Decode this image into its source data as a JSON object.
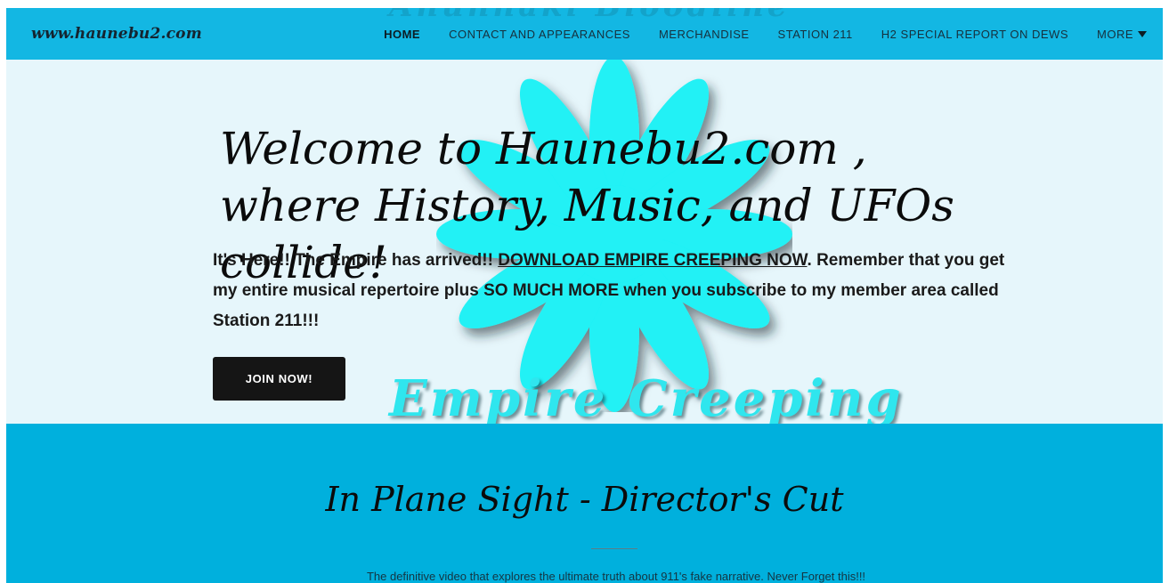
{
  "header": {
    "logo": "www.haunebu2.com",
    "ghost_text": "Anunnaki Bloodline",
    "nav": [
      {
        "label": "HOME",
        "active": true
      },
      {
        "label": "CONTACT AND APPEARANCES",
        "active": false
      },
      {
        "label": "MERCHANDISE",
        "active": false
      },
      {
        "label": "STATION 211",
        "active": false
      },
      {
        "label": "H2 SPECIAL REPORT ON DEWS",
        "active": false
      },
      {
        "label": "MORE",
        "active": false
      }
    ]
  },
  "hero": {
    "title": "Welcome to Haunebu2.com , where History, Music, and UFOs collide!",
    "body_before": "It's Here!! The Empire has arrived!! ",
    "link_text": "DOWNLOAD EMPIRE CREEPING NOW",
    "body_after": ". Remember that you get my entire musical repertoire plus SO MUCH MORE when you subscribe to my member area called Station 211!!!",
    "button_label": "JOIN NOW!",
    "overlay_text": "Empire Creeping"
  },
  "section": {
    "title": "In Plane Sight - Director's Cut",
    "text": "The definitive  video that explores the ultimate truth about 911's fake narrative.  Never Forget this!!!"
  },
  "colors": {
    "header_bg": "#13b7e3",
    "hero_bg": "#e6f6fb",
    "flower": "#20f1f5",
    "section_bg": "#00b0dd",
    "button_bg": "#151515"
  }
}
